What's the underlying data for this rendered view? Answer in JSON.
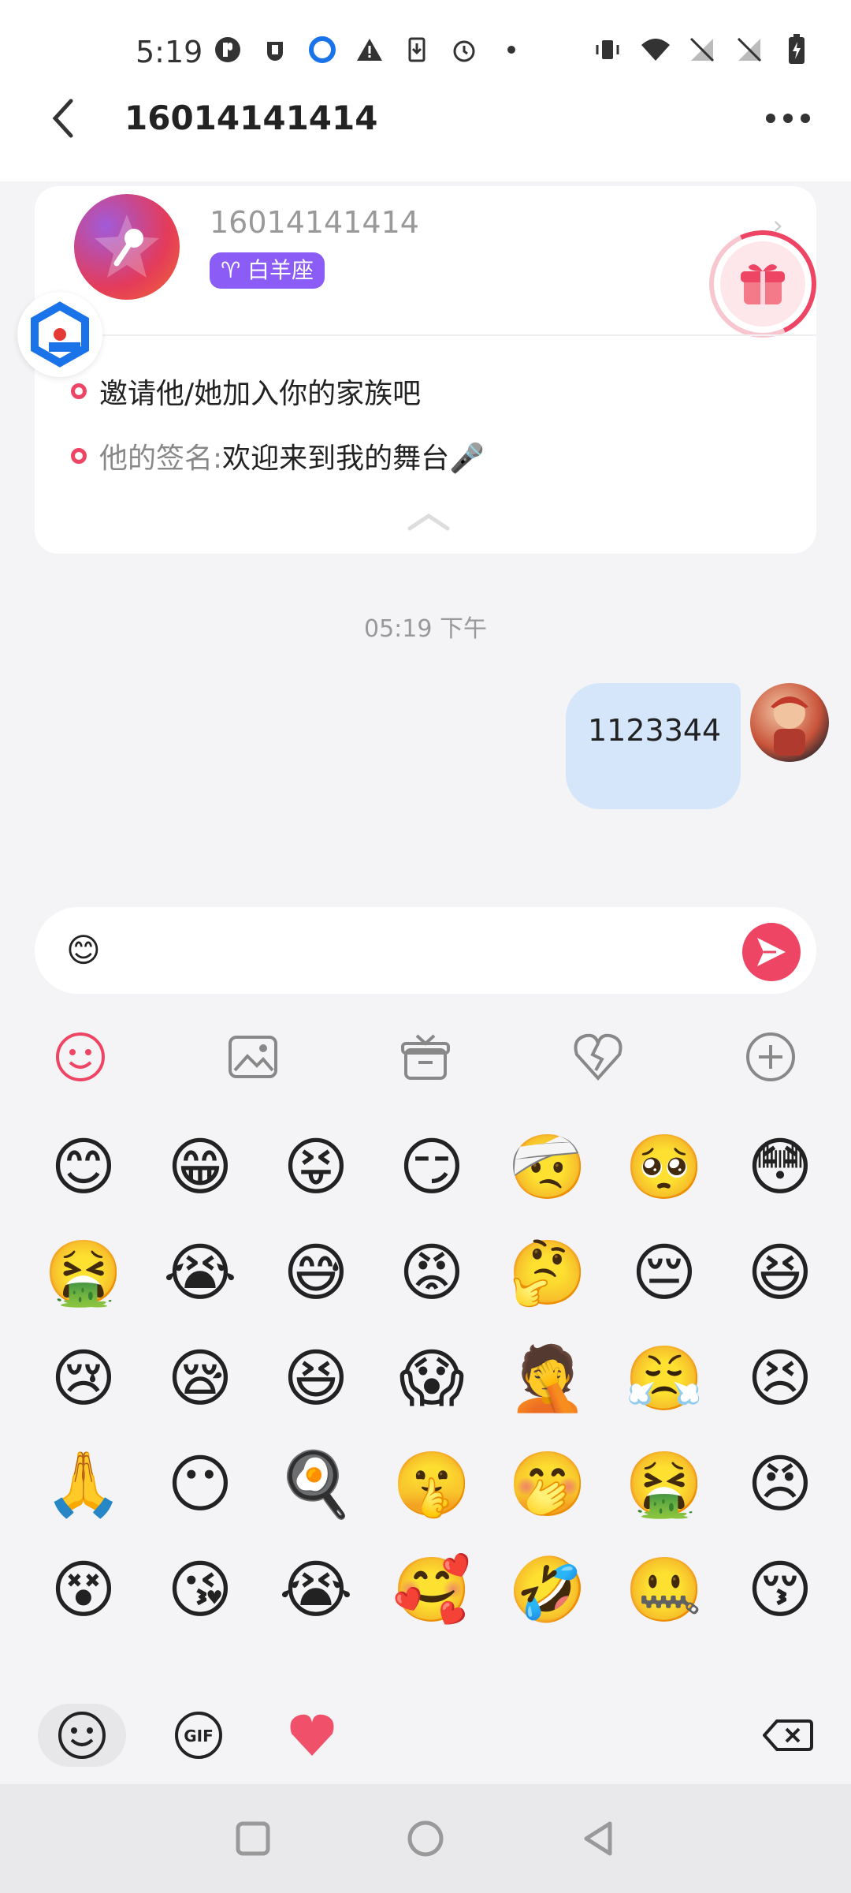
{
  "status": {
    "time": "5:19",
    "icons_left": [
      "p-app-icon",
      "shield-icon",
      "browser-icon",
      "warning-icon",
      "download-icon",
      "alarm-icon",
      "dot-icon"
    ],
    "icons_right": [
      "vibrate-icon",
      "wifi-icon",
      "no-signal-icon",
      "no-signal-icon",
      "battery-charging-icon"
    ]
  },
  "header": {
    "title": "16014141414"
  },
  "profile": {
    "name": "16014141414",
    "zodiac": "♈ 白羊座",
    "invite_text": "邀请他/她加入你的家族吧",
    "signature_label": "他的签名:",
    "signature_value": " 欢迎来到我的舞台🎤"
  },
  "chat": {
    "timestamp": "05:19 下午",
    "message": "1123344"
  },
  "input": {
    "value": "😊"
  },
  "toolbar": [
    "emoji-icon",
    "image-icon",
    "gift-icon",
    "heart-broken-icon",
    "plus-icon"
  ],
  "emoji_grid": [
    [
      "😊",
      "😁",
      "😝",
      "😏",
      "🤕",
      "🥺",
      "😳"
    ],
    [
      "🤮",
      "😭",
      "😅",
      "😡",
      "🤔",
      "😔",
      "😆"
    ],
    [
      "😢",
      "😪",
      "😆",
      "😱",
      "🤦",
      "😤",
      "😣"
    ],
    [
      "🙏",
      "😶",
      "🍳",
      "🤫",
      "🤭",
      "🤮",
      "😠"
    ],
    [
      "😵",
      "😘",
      "😭",
      "🥰",
      "🤣",
      "🤐",
      "😚"
    ]
  ],
  "bottom": [
    "emoji-tab",
    "gif-tab",
    "heart-tab",
    "delete-icon"
  ],
  "bottom_gif_label": "GIF",
  "colors": {
    "accent": "#ef4565",
    "bubble": "#d5e6fb",
    "zodiac": "#8b5cf6"
  }
}
